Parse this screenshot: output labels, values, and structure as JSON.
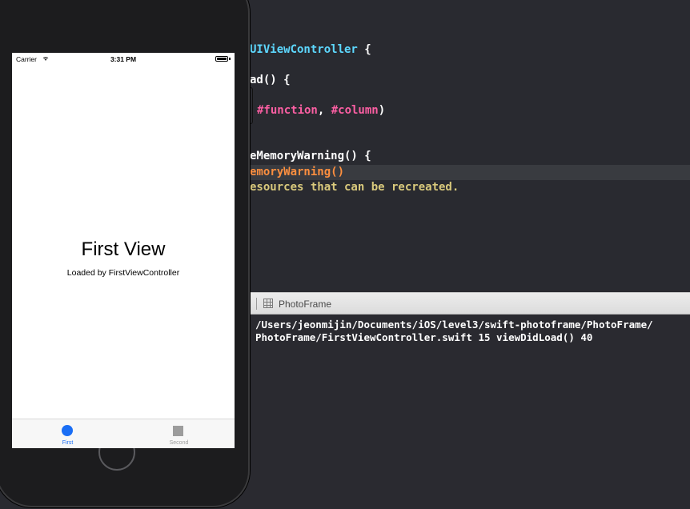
{
  "editor": {
    "lines": [
      [
        {
          "t": "UIViewController",
          "c": "cyan"
        },
        {
          "t": " {",
          "c": ""
        }
      ],
      [
        {
          "t": "ad() {",
          "c": ""
        }
      ],
      [
        {
          "t": "#function",
          "c": "pink"
        },
        {
          "t": ", ",
          "c": ""
        },
        {
          "t": "#column",
          "c": "pink"
        },
        {
          "t": ")",
          "c": ""
        }
      ],
      [
        {
          "t": "eMemoryWarning() {",
          "c": ""
        }
      ],
      [
        {
          "t": "emoryWarning()",
          "c": "orange"
        }
      ],
      [
        {
          "t": "esources that can be recreated.",
          "c": "yellow"
        }
      ]
    ]
  },
  "debug": {
    "target_label": "PhotoFrame",
    "console_lines": [
      "/Users/jeonmijin/Documents/iOS/level3/swift-photoframe/PhotoFrame/",
      "PhotoFrame/FirstViewController.swift 15 viewDidLoad() 40"
    ]
  },
  "simulator": {
    "carrier": "Carrier",
    "time": "3:31 PM",
    "title": "First View",
    "subtitle": "Loaded by FirstViewController",
    "tabs": [
      {
        "label": "First",
        "icon": "circle-icon",
        "selected": true
      },
      {
        "label": "Second",
        "icon": "square-icon",
        "selected": false
      }
    ],
    "colors": {
      "accent": "#1a6ef5",
      "inactive": "#9c9c9c"
    }
  }
}
